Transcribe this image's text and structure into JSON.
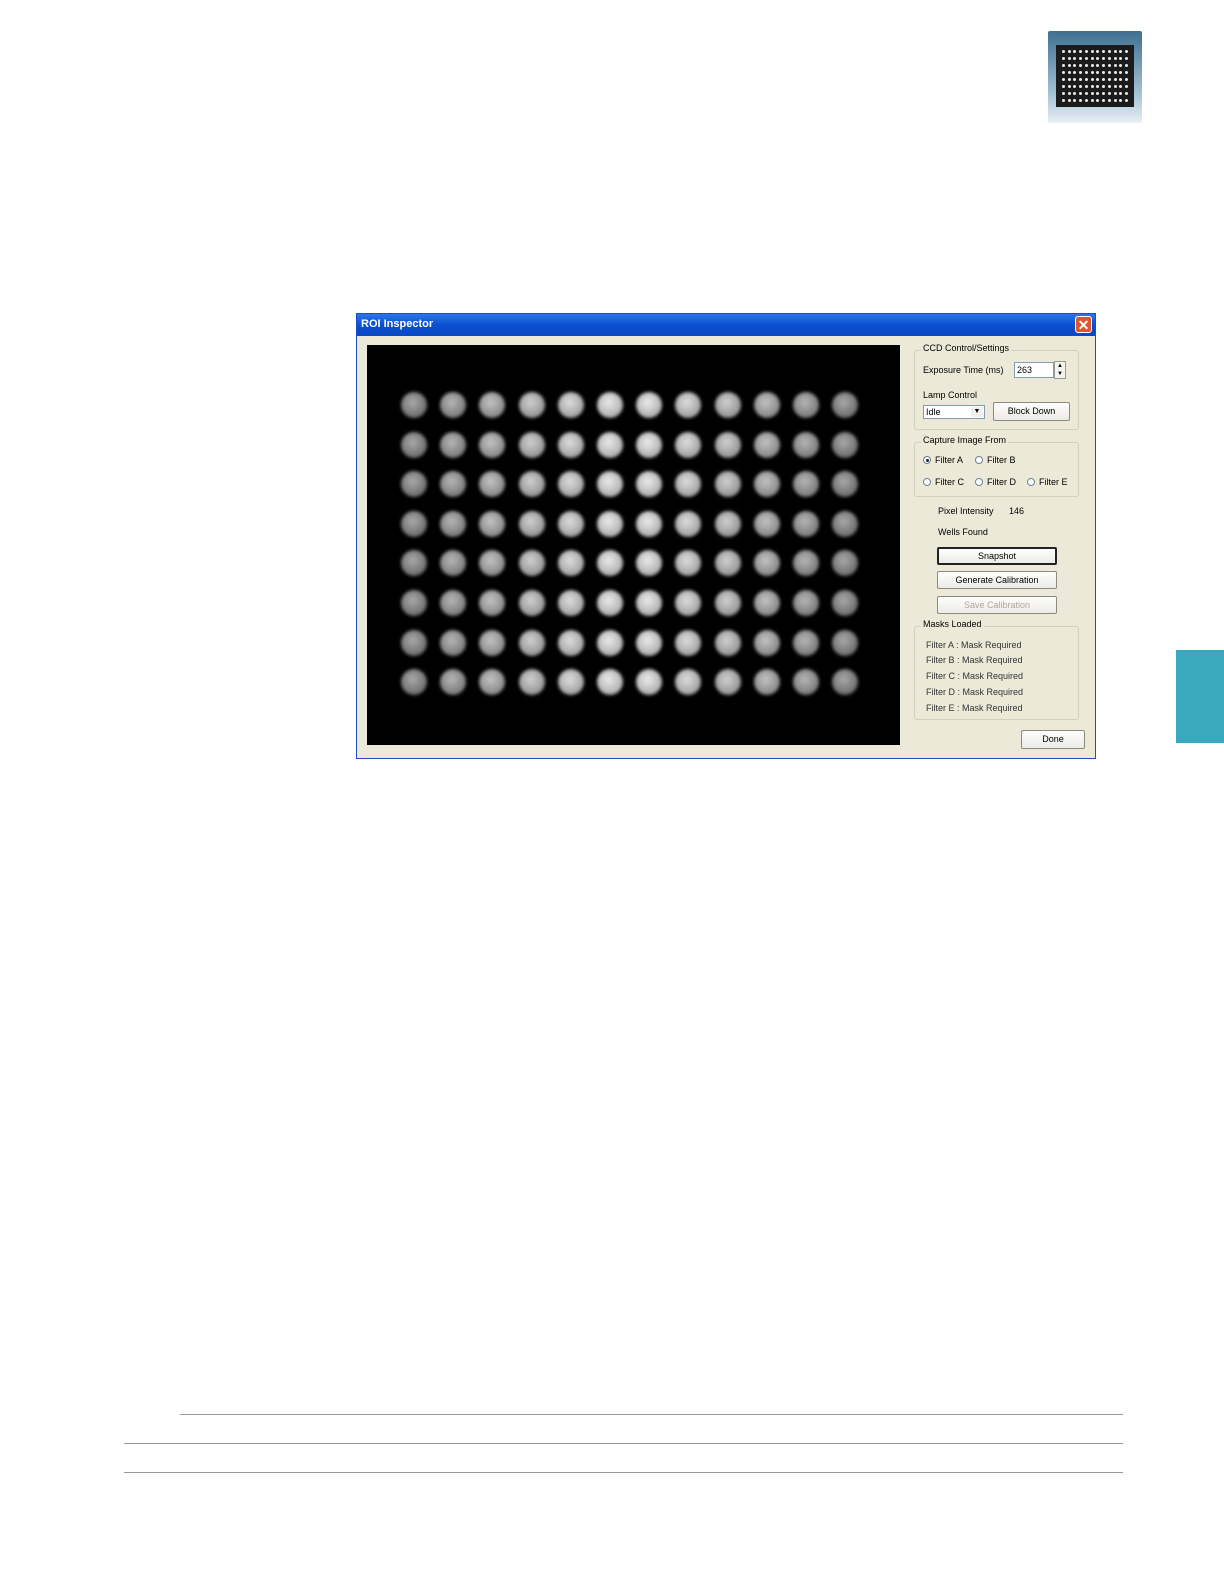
{
  "dialog": {
    "title": "ROI Inspector",
    "close_glyph": "✕"
  },
  "ccd": {
    "group_label": "CCD Control/Settings",
    "exposure_label": "Exposure Time (ms)",
    "exposure_value": "263",
    "lamp_label": "Lamp Control",
    "lamp_value": "Idle",
    "block_button": "Block Down"
  },
  "capture": {
    "group_label": "Capture Image From",
    "filters": [
      {
        "label": "Filter A",
        "selected": true
      },
      {
        "label": "Filter B",
        "selected": false
      },
      {
        "label": "Filter C",
        "selected": false
      },
      {
        "label": "Filter D",
        "selected": false
      },
      {
        "label": "Filter E",
        "selected": false
      }
    ]
  },
  "stats": {
    "pixel_label": "Pixel Intensity",
    "pixel_value": "146",
    "wells_label": "Wells Found"
  },
  "buttons": {
    "snapshot": "Snapshot",
    "generate": "Generate Calibration",
    "save": "Save Calibration",
    "done": "Done"
  },
  "masks": {
    "group_label": "Masks Loaded",
    "items": [
      "Filter A : Mask Required",
      "Filter B : Mask Required",
      "Filter C : Mask Required",
      "Filter D : Mask Required",
      "Filter E : Mask Required"
    ]
  },
  "plate_image": {
    "rows": 8,
    "cols": 12
  }
}
